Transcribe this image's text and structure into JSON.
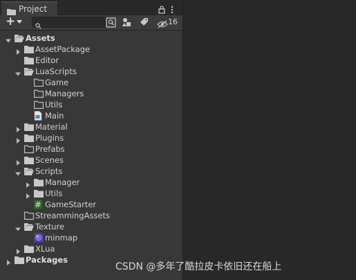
{
  "window": {
    "tab_label": "Project",
    "hidden_count": "16"
  },
  "search": {
    "value": "",
    "placeholder": ""
  },
  "tree": [
    {
      "label": "Assets",
      "depth": 0,
      "expander": "open",
      "icon": "folder-open-icon",
      "bold": true
    },
    {
      "label": "AssetPackage",
      "depth": 1,
      "expander": "closed",
      "icon": "folder-filled-icon"
    },
    {
      "label": "Editor",
      "depth": 1,
      "expander": "none",
      "icon": "folder-filled-icon"
    },
    {
      "label": "LuaScripts",
      "depth": 1,
      "expander": "open",
      "icon": "folder-open-icon"
    },
    {
      "label": "Game",
      "depth": 2,
      "expander": "none",
      "icon": "folder-empty-icon"
    },
    {
      "label": "Managers",
      "depth": 2,
      "expander": "none",
      "icon": "folder-empty-icon"
    },
    {
      "label": "Utils",
      "depth": 2,
      "expander": "none",
      "icon": "folder-empty-icon"
    },
    {
      "label": "Main",
      "depth": 2,
      "expander": "none",
      "icon": "lua-file-icon"
    },
    {
      "label": "Material",
      "depth": 1,
      "expander": "closed",
      "icon": "folder-filled-icon"
    },
    {
      "label": "Plugins",
      "depth": 1,
      "expander": "closed",
      "icon": "folder-filled-icon"
    },
    {
      "label": "Prefabs",
      "depth": 1,
      "expander": "none",
      "icon": "folder-empty-icon"
    },
    {
      "label": "Scenes",
      "depth": 1,
      "expander": "closed",
      "icon": "folder-filled-icon"
    },
    {
      "label": "Scripts",
      "depth": 1,
      "expander": "open",
      "icon": "folder-open-icon"
    },
    {
      "label": "Manager",
      "depth": 2,
      "expander": "closed",
      "icon": "folder-filled-icon"
    },
    {
      "label": "Utils",
      "depth": 2,
      "expander": "closed",
      "icon": "folder-filled-icon"
    },
    {
      "label": "GameStarter",
      "depth": 2,
      "expander": "none",
      "icon": "csharp-script-icon"
    },
    {
      "label": "StreammingAssets",
      "depth": 1,
      "expander": "none",
      "icon": "folder-empty-icon"
    },
    {
      "label": "Texture",
      "depth": 1,
      "expander": "open",
      "icon": "folder-open-icon"
    },
    {
      "label": "minmap",
      "depth": 2,
      "expander": "none",
      "icon": "texture-icon"
    },
    {
      "label": "XLua",
      "depth": 1,
      "expander": "closed",
      "icon": "folder-filled-icon"
    },
    {
      "label": "Packages",
      "depth": 0,
      "expander": "closed",
      "icon": "folder-filled-icon",
      "bold": true
    }
  ],
  "watermark": "CSDN @多年了酷拉皮卡依旧还在船上",
  "colors": {
    "panel_bg": "#383838",
    "empty_bg": "#282828",
    "text": "#d2d2d2",
    "icon": "#c8c8c8",
    "csharp_green": "#3c9a3c",
    "texture_purple": "#6b5fc7"
  }
}
